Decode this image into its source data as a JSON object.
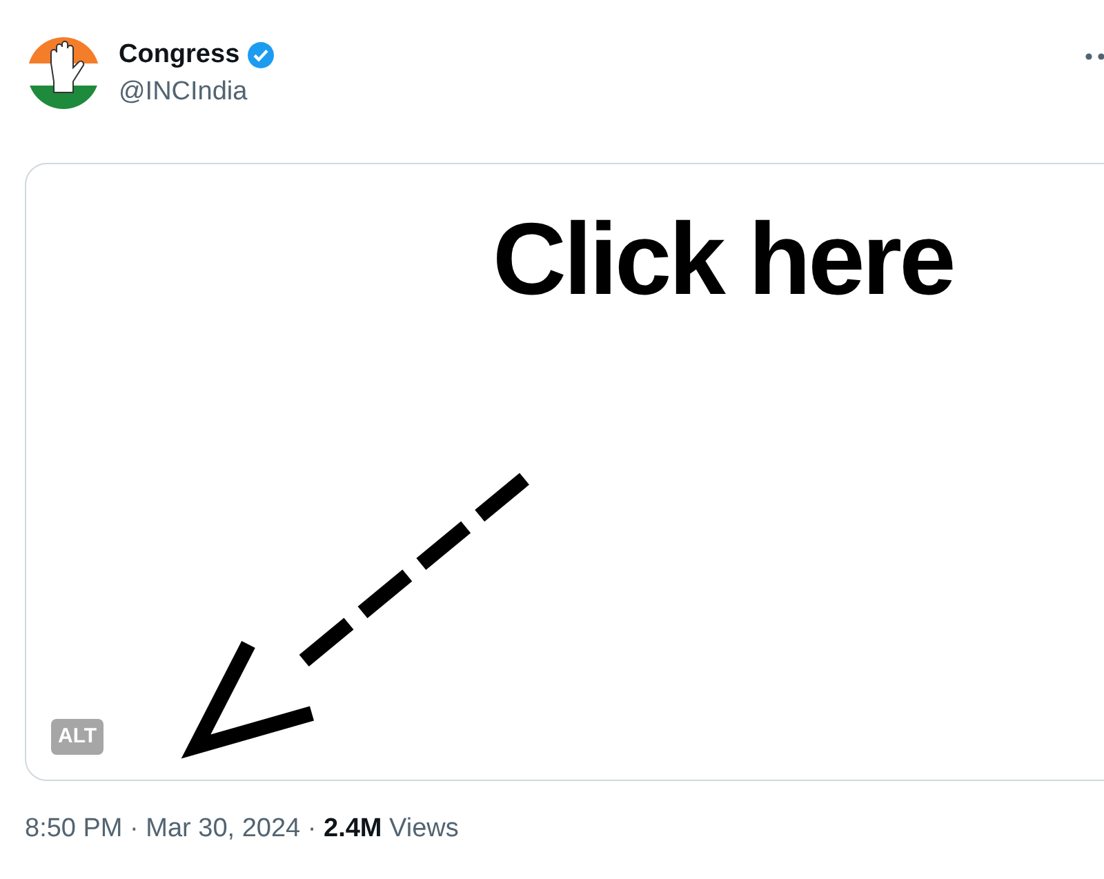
{
  "author": {
    "name": "Congress",
    "verified": true,
    "handle": "@INCIndia"
  },
  "media": {
    "headline": "Click here",
    "alt_badge": "ALT"
  },
  "footer": {
    "meta": "8:50 PM · Mar 30, 2024 · **2.4M** Views"
  }
}
